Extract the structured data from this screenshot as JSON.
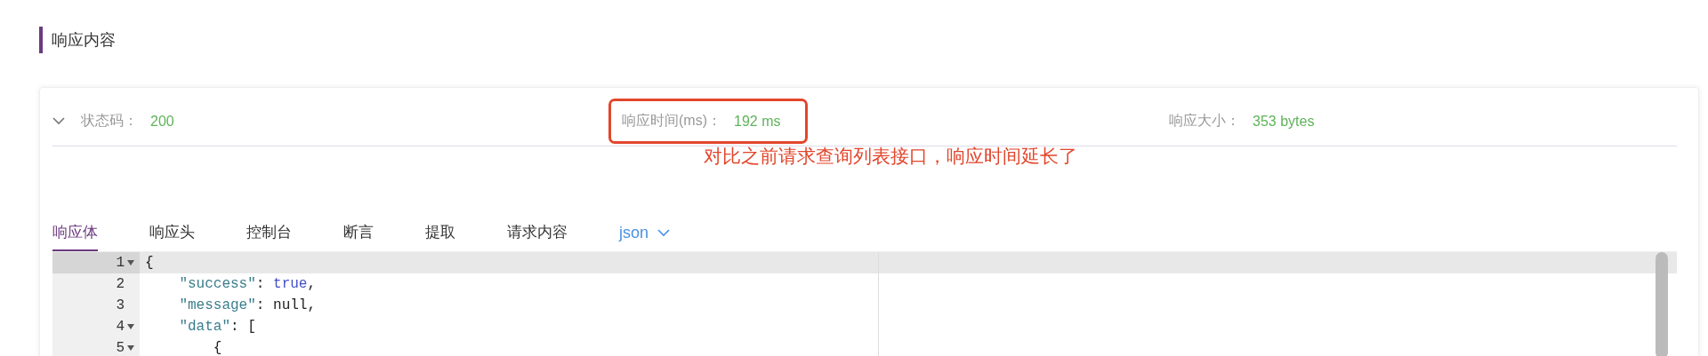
{
  "section_title": "响应内容",
  "summary": [
    {
      "label": "状态码：",
      "value": "200",
      "highlighted": false
    },
    {
      "label": "响应时间(ms)：",
      "value": "192 ms",
      "highlighted": true
    },
    {
      "label": "响应大小：",
      "value": "353 bytes",
      "highlighted": false
    }
  ],
  "annotation": "对比之前请求查询列表接口，响应时间延长了",
  "tabs": [
    {
      "label": "响应体",
      "selected": true
    },
    {
      "label": "响应头",
      "selected": false
    },
    {
      "label": "控制台",
      "selected": false
    },
    {
      "label": "断言",
      "selected": false
    },
    {
      "label": "提取",
      "selected": false
    },
    {
      "label": "请求内容",
      "selected": false
    }
  ],
  "format_select": {
    "value": "json"
  },
  "code_lines": [
    {
      "number": "1",
      "foldable": true,
      "active": true,
      "parts": [
        {
          "kind": "punct",
          "text": "{"
        }
      ]
    },
    {
      "number": "2",
      "foldable": false,
      "active": false,
      "parts": [
        {
          "kind": "key",
          "text": "    \"success\""
        },
        {
          "kind": "punct",
          "text": ": "
        },
        {
          "kind": "literal",
          "text": "true"
        },
        {
          "kind": "punct",
          "text": ","
        }
      ]
    },
    {
      "number": "3",
      "foldable": false,
      "active": false,
      "parts": [
        {
          "kind": "key",
          "text": "    \"message\""
        },
        {
          "kind": "punct",
          "text": ": null,"
        }
      ]
    },
    {
      "number": "4",
      "foldable": true,
      "active": false,
      "parts": [
        {
          "kind": "key",
          "text": "    \"data\""
        },
        {
          "kind": "punct",
          "text": ": ["
        }
      ]
    },
    {
      "number": "5",
      "foldable": true,
      "active": false,
      "parts": [
        {
          "kind": "punct",
          "text": "        {"
        }
      ]
    }
  ]
}
